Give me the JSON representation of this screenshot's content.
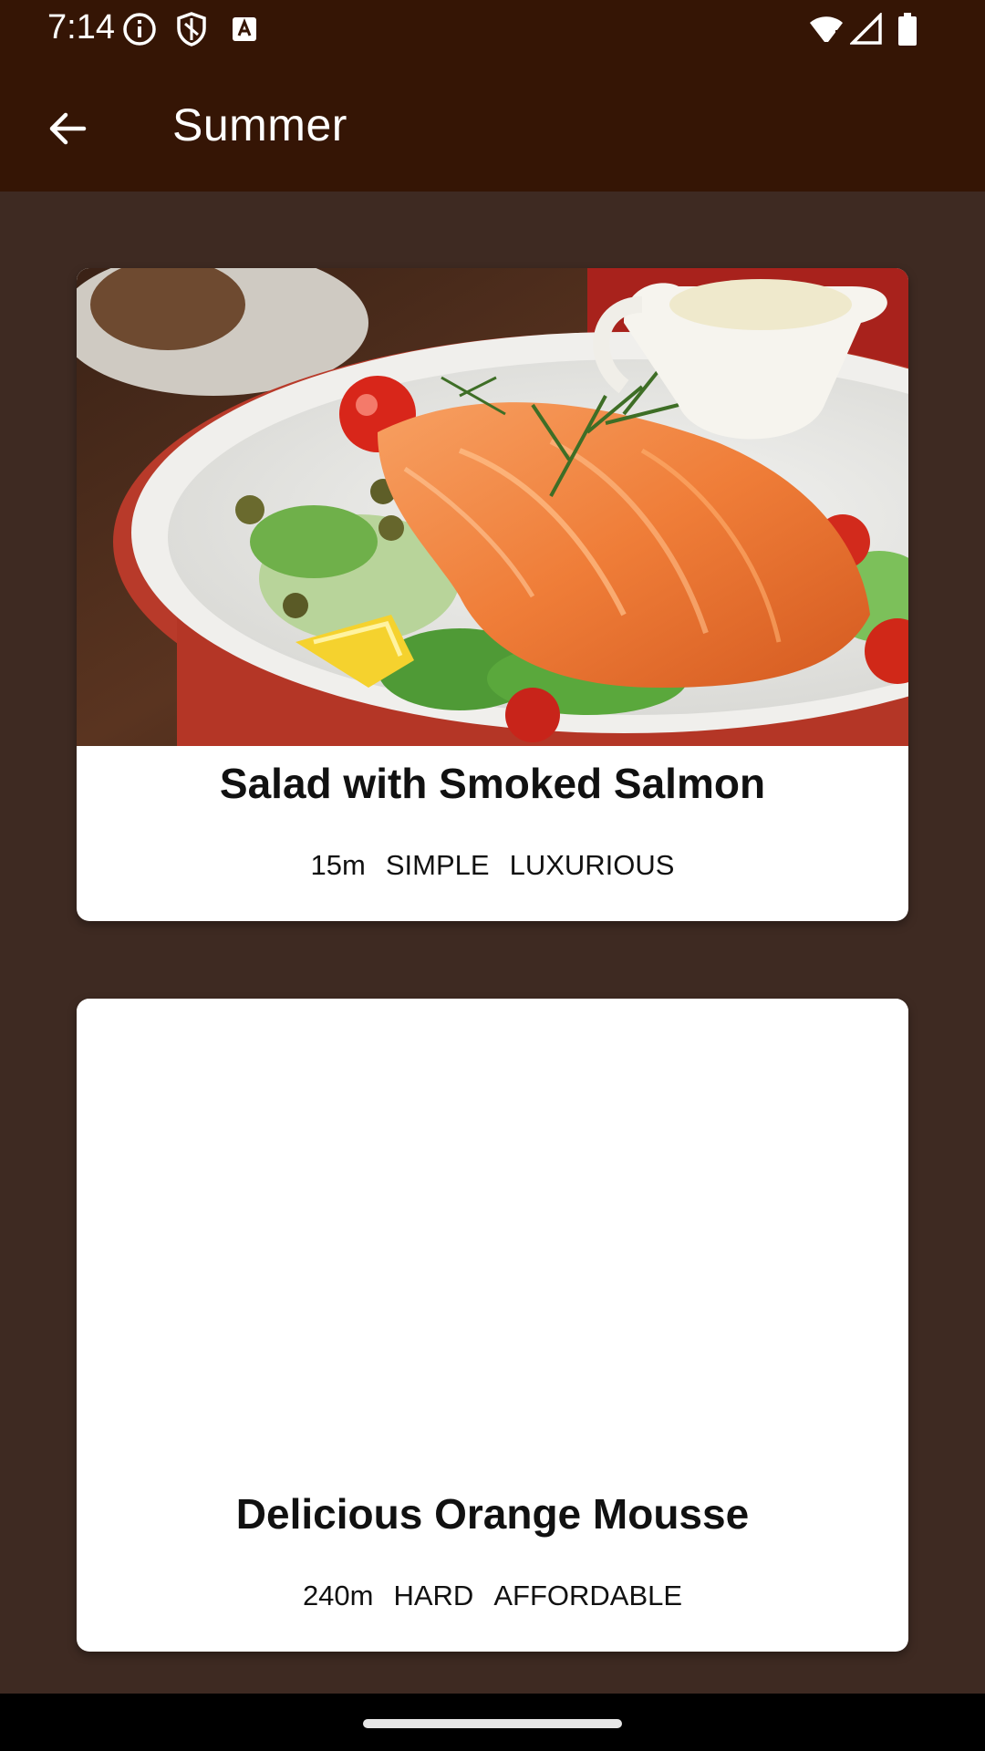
{
  "status_bar": {
    "time": "7:14",
    "icons_left": [
      "info-icon",
      "shield-icon",
      "text-a-icon"
    ],
    "icons_right": [
      "wifi-icon",
      "signal-icon",
      "battery-icon"
    ]
  },
  "app_bar": {
    "back_icon": "arrow-back-icon",
    "title": "Summer"
  },
  "meals": [
    {
      "title": "Salad with Smoked Salmon",
      "duration": "15m",
      "complexity": "SIMPLE",
      "affordability": "LUXURIOUS",
      "image": "smoked-salmon-salad-photo"
    },
    {
      "title": "Delicious Orange Mousse",
      "duration": "240m",
      "complexity": "HARD",
      "affordability": "AFFORDABLE",
      "image": "blank"
    }
  ],
  "colors": {
    "app_bar": "#351505",
    "background": "#3e2a22",
    "card": "#ffffff",
    "text": "#111111"
  }
}
